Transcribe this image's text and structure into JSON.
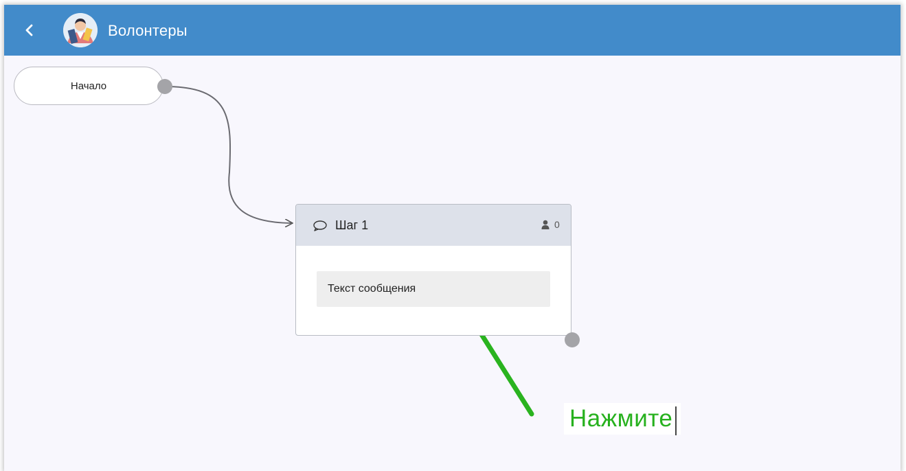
{
  "header": {
    "back_icon": "chevron-left-icon",
    "avatar_icon": "volunteer-avatar",
    "title": "Волонтеры"
  },
  "flow": {
    "start_node": {
      "label": "Начало"
    },
    "step_node": {
      "icon": "chat-bubble-icon",
      "title": "Шаг 1",
      "user_icon": "user-icon",
      "user_count": "0",
      "message_placeholder": "Текст сообщения"
    }
  },
  "annotation": {
    "text": "Нажмите",
    "color": "#27b11e"
  },
  "colors": {
    "header_bg": "#428bca",
    "canvas_bg": "#f8f7fd",
    "step_header_bg": "#dde1ea",
    "port": "#a4a4a8",
    "arrow": "#2ab31f"
  }
}
